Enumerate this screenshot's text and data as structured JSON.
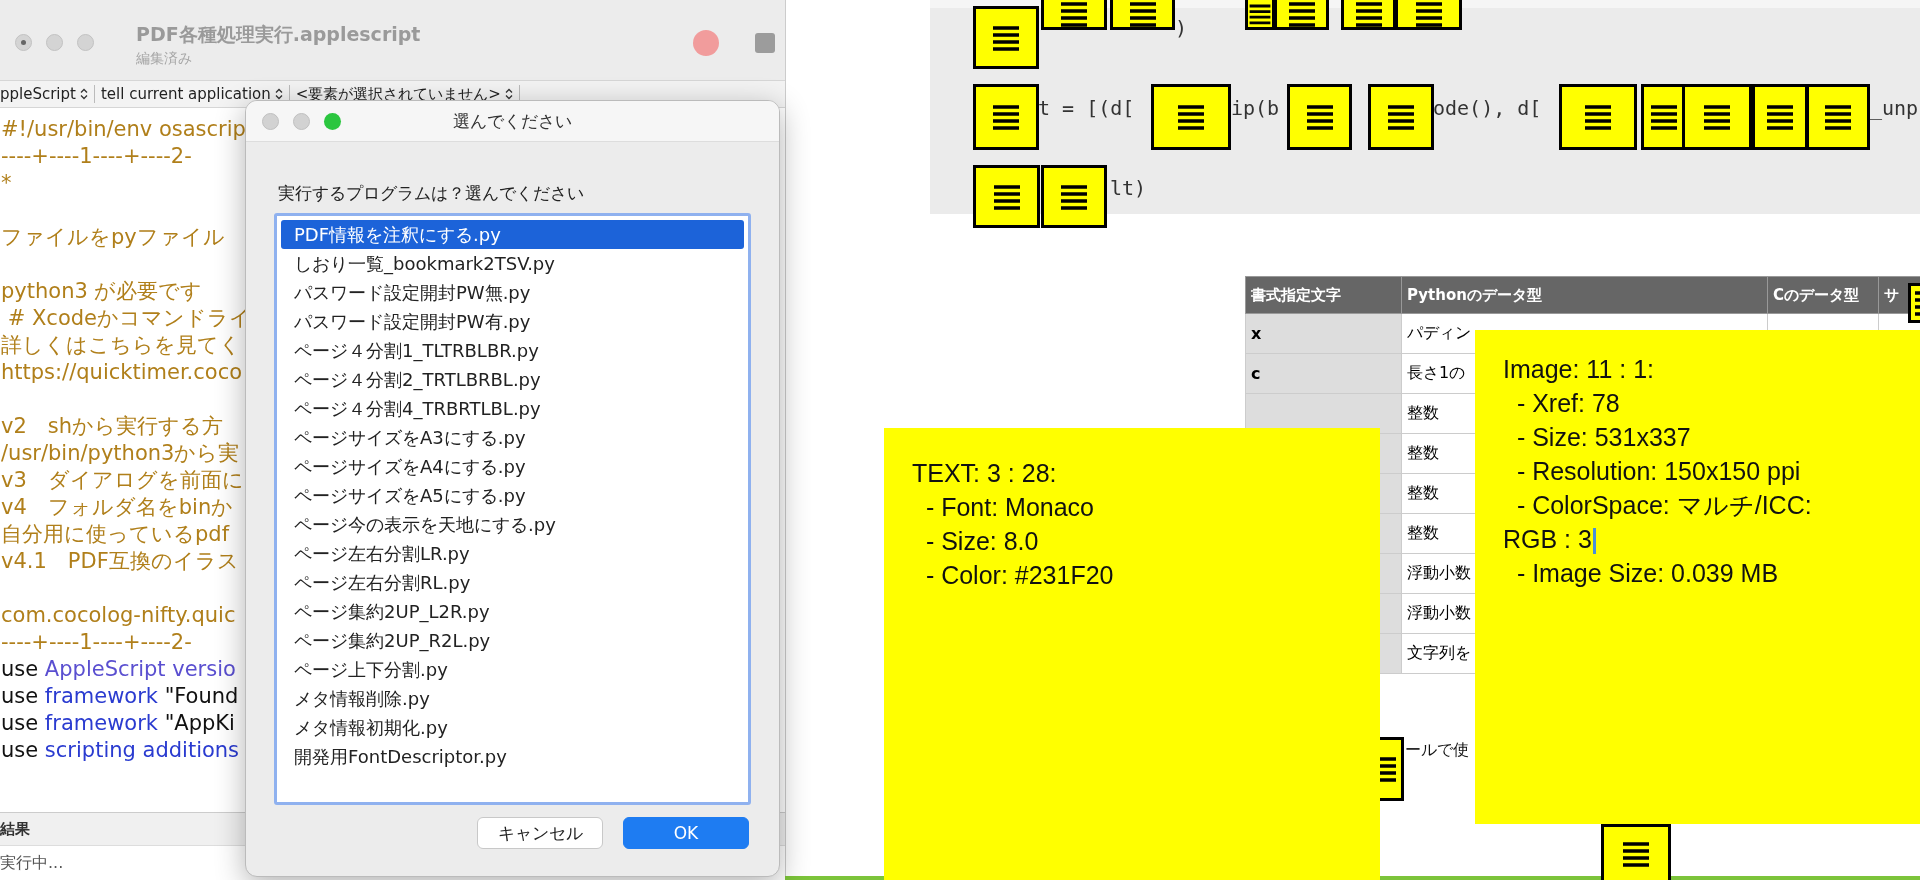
{
  "editor": {
    "title": "PDF各種処理実行.applescript",
    "subtitle": "編集済み",
    "toolbar": [
      "ppleScript",
      "tell current application",
      "<要素が選択されていません>"
    ],
    "lines": [
      {
        "kind": "code",
        "tokens": [
          {
            "kind": "comment",
            "text": "#!/usr/bin/env osascrip"
          }
        ]
      },
      {
        "kind": "code",
        "tokens": [
          {
            "kind": "comment",
            "text": "----+----1----+----2-"
          }
        ]
      },
      {
        "kind": "code",
        "tokens": [
          {
            "kind": "comment",
            "text": "*"
          }
        ]
      },
      {
        "kind": "blank"
      },
      {
        "kind": "code",
        "tokens": [
          {
            "kind": "comment",
            "text": "ファイルをpyファイル"
          }
        ]
      },
      {
        "kind": "blank"
      },
      {
        "kind": "code",
        "tokens": [
          {
            "kind": "comment",
            "text": "python3 が必要です"
          }
        ]
      },
      {
        "kind": "code",
        "tokens": [
          {
            "kind": "comment",
            "text": " # Xcodeかコマンドライ"
          }
        ]
      },
      {
        "kind": "code",
        "tokens": [
          {
            "kind": "comment",
            "text": "詳しくはこちらを見てく"
          }
        ]
      },
      {
        "kind": "code",
        "tokens": [
          {
            "kind": "comment",
            "text": "https://quicktimer.coco"
          }
        ]
      },
      {
        "kind": "blank"
      },
      {
        "kind": "code",
        "tokens": [
          {
            "kind": "comment",
            "text": "v2　shから実行する方"
          }
        ]
      },
      {
        "kind": "code",
        "tokens": [
          {
            "kind": "comment",
            "text": "/usr/bin/python3から実"
          }
        ]
      },
      {
        "kind": "code",
        "tokens": [
          {
            "kind": "comment",
            "text": "v3　ダイアログを前面に"
          }
        ]
      },
      {
        "kind": "code",
        "tokens": [
          {
            "kind": "comment",
            "text": "v4　フォルダ名をbinか"
          }
        ]
      },
      {
        "kind": "code",
        "tokens": [
          {
            "kind": "comment",
            "text": "自分用に使っているpdf"
          }
        ]
      },
      {
        "kind": "code",
        "tokens": [
          {
            "kind": "comment",
            "text": "v4.1　PDF互換のイラス"
          }
        ]
      },
      {
        "kind": "blank"
      },
      {
        "kind": "code",
        "tokens": [
          {
            "kind": "comment",
            "text": "com.cocolog-nifty.quic"
          }
        ]
      },
      {
        "kind": "code",
        "tokens": [
          {
            "kind": "comment",
            "text": "----+----1----+----2-"
          }
        ]
      },
      {
        "kind": "code",
        "tokens": [
          {
            "kind": "plain",
            "text": "use "
          },
          {
            "kind": "app",
            "text": "AppleScript versio"
          }
        ]
      },
      {
        "kind": "code",
        "tokens": [
          {
            "kind": "plain",
            "text": "use "
          },
          {
            "kind": "keyword",
            "text": "framework"
          },
          {
            "kind": "plain",
            "text": " \"Found"
          }
        ]
      },
      {
        "kind": "code",
        "tokens": [
          {
            "kind": "plain",
            "text": "use "
          },
          {
            "kind": "keyword",
            "text": "framework"
          },
          {
            "kind": "plain",
            "text": " \"AppKi"
          }
        ]
      },
      {
        "kind": "code",
        "tokens": [
          {
            "kind": "plain",
            "text": "use "
          },
          {
            "kind": "keyword",
            "text": "scripting additions"
          }
        ]
      }
    ],
    "result_label": "結果",
    "status": "実行中..."
  },
  "dialog": {
    "title": "選んでください",
    "prompt": "実行するプログラムは？選んでください",
    "items": [
      {
        "label": "PDF情報を注釈にする.py",
        "selected": true
      },
      {
        "label": "しおり一覧_bookmark2TSV.py",
        "selected": false
      },
      {
        "label": "パスワード設定開封PW無.py",
        "selected": false
      },
      {
        "label": "パスワード設定開封PW有.py",
        "selected": false
      },
      {
        "label": "ページ４分割1_TLTRBLBR.py",
        "selected": false
      },
      {
        "label": "ページ４分割2_TRTLBRBL.py",
        "selected": false
      },
      {
        "label": "ページ４分割4_TRBRTLBL.py",
        "selected": false
      },
      {
        "label": "ページサイズをA3にする.py",
        "selected": false
      },
      {
        "label": "ページサイズをA4にする.py",
        "selected": false
      },
      {
        "label": "ページサイズをA5にする.py",
        "selected": false
      },
      {
        "label": "ページ今の表示を天地にする.py",
        "selected": false
      },
      {
        "label": "ページ左右分割LR.py",
        "selected": false
      },
      {
        "label": "ページ左右分割RL.py",
        "selected": false
      },
      {
        "label": "ページ集約2UP_L2R.py",
        "selected": false
      },
      {
        "label": "ページ集約2UP_R2L.py",
        "selected": false
      },
      {
        "label": "ページ上下分割.py",
        "selected": false
      },
      {
        "label": "メタ情報削除.py",
        "selected": false
      },
      {
        "label": "メタ情報初期化.py",
        "selected": false
      },
      {
        "label": "開発用FontDescriptor.py",
        "selected": false
      }
    ],
    "buttons": [
      {
        "label": "キャンセル",
        "kind": "cancel"
      },
      {
        "label": "OK",
        "kind": "default"
      }
    ]
  },
  "document": {
    "code": [
      ")",
      "t = [(d[",
      "ip(b",
      "ode(), d[",
      "_unp",
      "lt)"
    ],
    "table": {
      "columns": [
        "書式指定文字",
        "Pythonのデータ型",
        "Cのデータ型",
        "サ"
      ],
      "rows": [
        {
          "format": "x",
          "python": "パディン"
        },
        {
          "format": "c",
          "python": "長さ1の"
        },
        {
          "python": "整数"
        },
        {
          "python": "整数"
        },
        {
          "python": "整数"
        },
        {
          "python": "整数"
        },
        {
          "python": "浮動小数"
        },
        {
          "python": "浮動小数"
        },
        {
          "python": "文字列を"
        }
      ]
    },
    "caption": "ールで使"
  },
  "notes": [
    {
      "lines": [
        {
          "text": "TEXT: 3 : 28:",
          "caret": false
        },
        {
          "text": "  - Font: Monaco",
          "caret": false
        },
        {
          "text": "  - Size: 8.0",
          "caret": false
        },
        {
          "text": "  - Color: #231F20",
          "caret": false
        }
      ]
    },
    {
      "lines": [
        {
          "text": "Image: 11 : 1:",
          "caret": false
        },
        {
          "text": "  - Xref: 78",
          "caret": false
        },
        {
          "text": "  - Size: 531x337",
          "caret": false
        },
        {
          "text": "  - Resolution: 150x150 ppi",
          "caret": false
        },
        {
          "text": "  - ColorSpace: マルチ/ICC:",
          "caret": false
        },
        {
          "text": "RGB : 3",
          "caret": true
        },
        {
          "text": "  - Image Size: 0.039 MB",
          "caret": false
        }
      ]
    }
  ]
}
